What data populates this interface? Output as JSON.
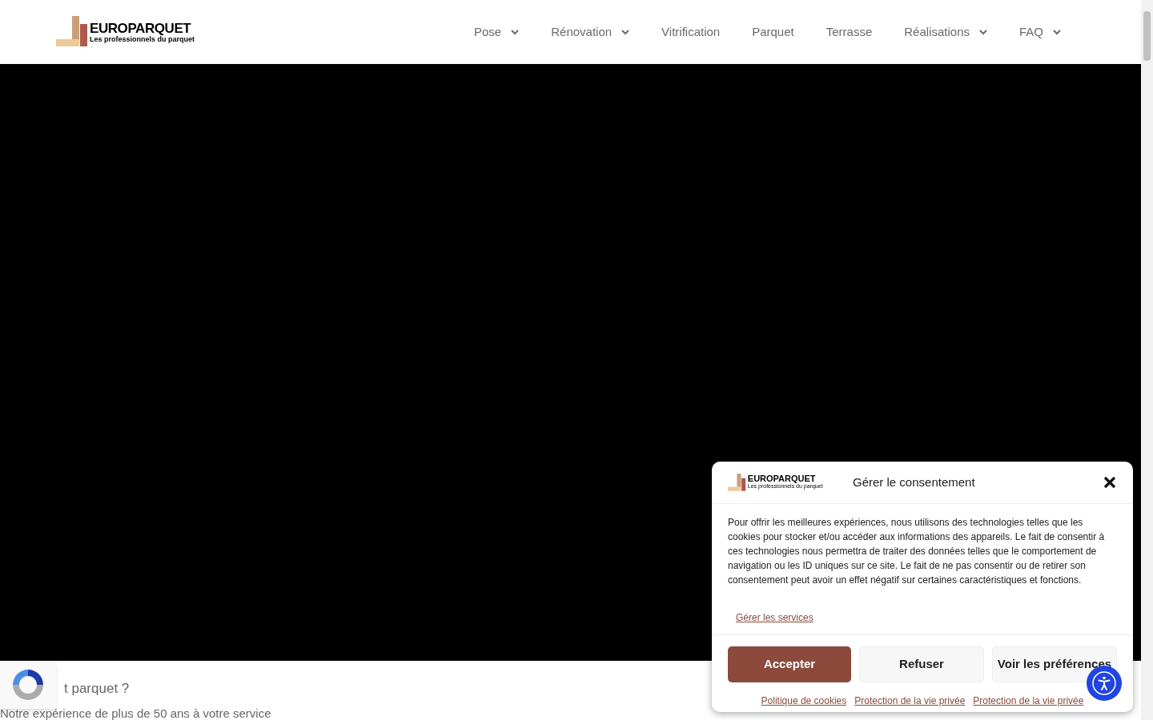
{
  "header": {
    "logo": {
      "name": "EUROPARQUET",
      "tagline": "Les professionnels du parquet"
    },
    "nav": [
      {
        "label": "Pose",
        "has_dropdown": true
      },
      {
        "label": "Rénovation",
        "has_dropdown": true
      },
      {
        "label": "Vitrification",
        "has_dropdown": false
      },
      {
        "label": "Parquet",
        "has_dropdown": false
      },
      {
        "label": "Terrasse",
        "has_dropdown": false
      },
      {
        "label": "Réalisations",
        "has_dropdown": true
      },
      {
        "label": "FAQ",
        "has_dropdown": true
      }
    ]
  },
  "content": {
    "heading": "t parquet ?",
    "subheading": "Notre expérience de plus de 50 ans à votre service"
  },
  "consent": {
    "logo": {
      "name": "EUROPARQUET",
      "tagline": "Les professionnels du parquet"
    },
    "title": "Gérer le consentement",
    "body": "Pour offrir les meilleures expériences, nous utilisons des technologies telles que les cookies pour stocker et/ou accéder aux informations des appareils. Le fait de consentir à ces technologies nous permettra de traiter des données telles que le comportement de navigation ou les ID uniques sur ce site. Le fait de ne pas consentir ou de retirer son consentement peut avoir un effet négatif sur certaines caractéristiques et fonctions.",
    "manage_link": "Gérer les services",
    "buttons": [
      {
        "label": "Accepter",
        "kind": "primary"
      },
      {
        "label": "Refuser",
        "kind": "secondary"
      },
      {
        "label": "Voir les préférences",
        "kind": "secondary"
      }
    ],
    "links": [
      "Politique de cookies",
      "Protection de la vie privée",
      "Protection de la vie privée"
    ]
  }
}
